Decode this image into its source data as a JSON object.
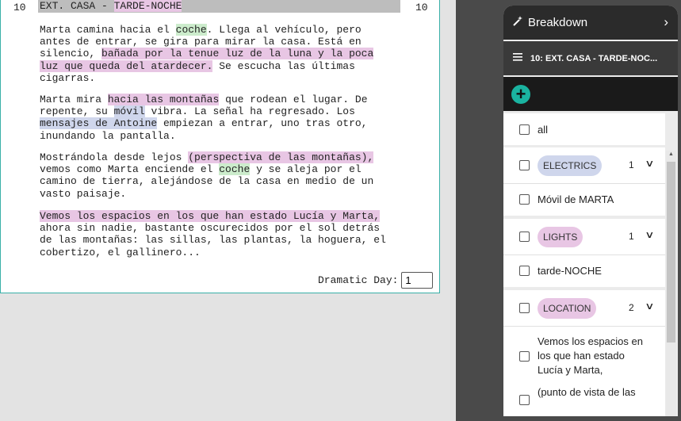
{
  "script": {
    "scene_number": "10",
    "heading": {
      "prefix": "EXT. CASA - ",
      "highlight": "TARDE-NOCHE"
    },
    "paragraphs": [
      [
        {
          "t": "Marta camina hacia el "
        },
        {
          "t": "coche",
          "hl": "green"
        },
        {
          "t": ". Llega al vehículo, pero\nantes de entrar, se gira para mirar la casa. Está en\nsilencio, "
        },
        {
          "t": "bañada por la tenue luz de la luna y la poca\nluz que queda del atardecer.",
          "hl": "pink"
        },
        {
          "t": " Se escucha las últimas\ncigarras."
        }
      ],
      [
        {
          "t": "Marta mira "
        },
        {
          "t": "hacia las montañas",
          "hl": "pink"
        },
        {
          "t": " que rodean el lugar. De\nrepente, su "
        },
        {
          "t": "móvil",
          "hl": "blue"
        },
        {
          "t": " vibra. La señal ha regresado. Los\n"
        },
        {
          "t": "mensajes de Antoine",
          "hl": "blue"
        },
        {
          "t": " empiezan a entrar, uno tras otro,\ninundando la pantalla."
        }
      ],
      [
        {
          "t": "Mostrándola desde lejos "
        },
        {
          "t": "(perspectiva de las montañas),",
          "hl": "pink"
        },
        {
          "t": "\nvemos como Marta enciende el "
        },
        {
          "t": "coche",
          "hl": "green"
        },
        {
          "t": " y se aleja por el\ncamino de tierra, alejándose de la casa en medio de un\nvasto paisaje."
        }
      ],
      [
        {
          "t": "Vemos los espacios en los que han estado Lucía y Marta,",
          "hl": "pink"
        },
        {
          "t": "\nahora sin nadie, bastante oscurecidos por el sol detrás\nde las montañas: las sillas, las plantas, la hoguera, el\ncobertizo, el gallinero..."
        }
      ]
    ],
    "dramatic_day_label": "Dramatic Day:",
    "dramatic_day_value": "1"
  },
  "colors": {
    "pink": "#e8c6e4",
    "green": "#cceccc",
    "blue": "#cfd6ec",
    "accent": "#1ab3a0"
  },
  "panel": {
    "title": "Breakdown",
    "title_icon": "magic-wand-icon",
    "scene_label": "10: EXT. CASA - TARDE-NOC...",
    "add_label": "+",
    "all_label": "all",
    "categories": [
      {
        "name": "ELECTRICS",
        "count": "1",
        "items": [
          "Móvil de MARTA"
        ]
      },
      {
        "name": "LIGHTS",
        "count": "1",
        "items": [
          "tarde-NOCHE"
        ]
      },
      {
        "name": "LOCATION",
        "count": "2",
        "items": [
          "Vemos los espacios en los que han estado Lucía y Marta,",
          "(punto de vista de las"
        ]
      }
    ]
  }
}
